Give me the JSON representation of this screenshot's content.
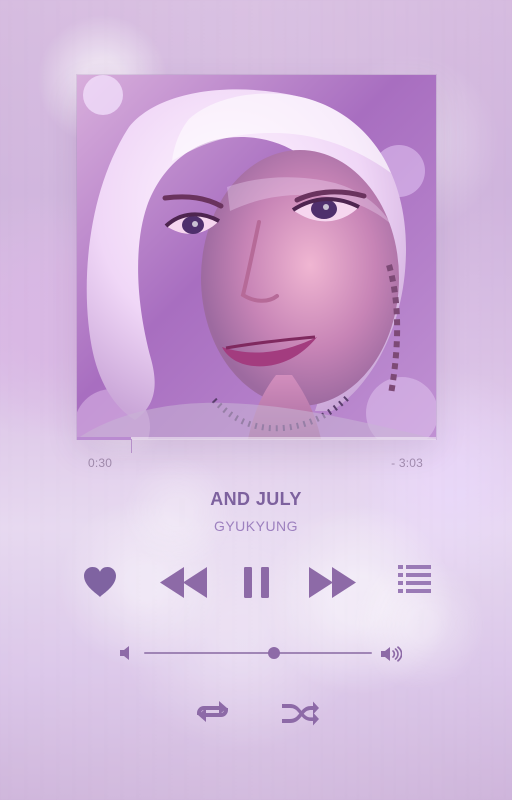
{
  "player": {
    "elapsed_time": "0:30",
    "remaining_time": "- 3:03",
    "progress_fraction": 0.15,
    "volume_fraction": 0.57,
    "track": {
      "title": "AND JULY",
      "artist": "GYUKYUNG"
    }
  },
  "controls": {
    "icons": {
      "heart": "heart-icon",
      "rewind": "rewind-icon",
      "pause": "pause-icon",
      "forward": "forward-icon",
      "playlist": "playlist-icon",
      "volume_low": "volume-low-icon",
      "volume_high": "volume-high-icon",
      "repeat": "repeat-icon",
      "shuffle": "shuffle-icon"
    }
  },
  "colors": {
    "accent": "#7d619e",
    "secondary": "#9d80bf",
    "icon": "#8d6aa7"
  }
}
